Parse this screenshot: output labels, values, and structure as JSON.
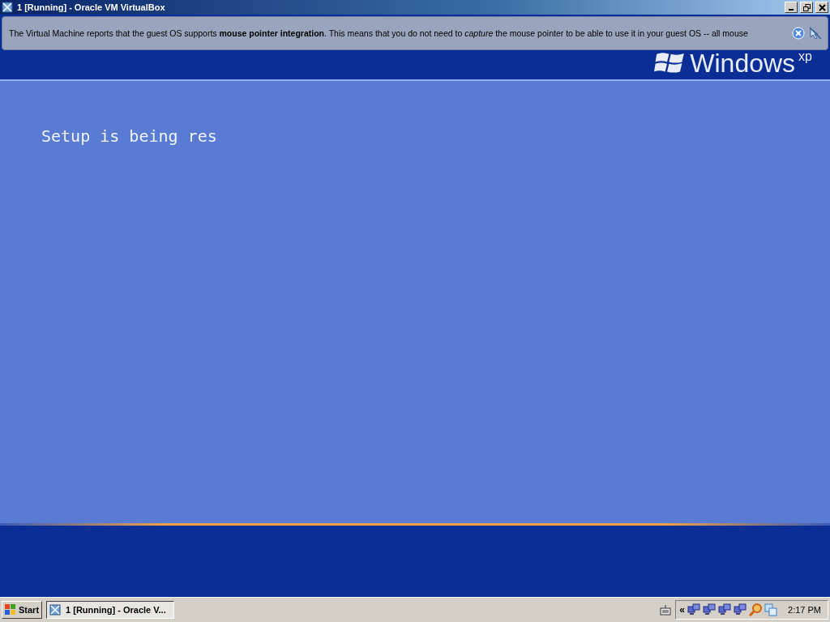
{
  "window": {
    "title": "1 [Running] - Oracle VM VirtualBox"
  },
  "notification": {
    "message": "The Virtual Machine reports that the guest OS supports **mouse pointer integration**. This means that you do not need to *capture* the mouse pointer to be able to use it in your guest OS -- all mouse"
  },
  "guest_screen": {
    "logo": {
      "word": "Windows",
      "edition": "xp"
    },
    "message": "Setup is being res"
  },
  "taskbar": {
    "start": "Start",
    "tasks": [
      {
        "label": "1 [Running] - Oracle V...",
        "selected": true
      }
    ],
    "tray_expand": "«",
    "clock": "2:17 PM"
  }
}
